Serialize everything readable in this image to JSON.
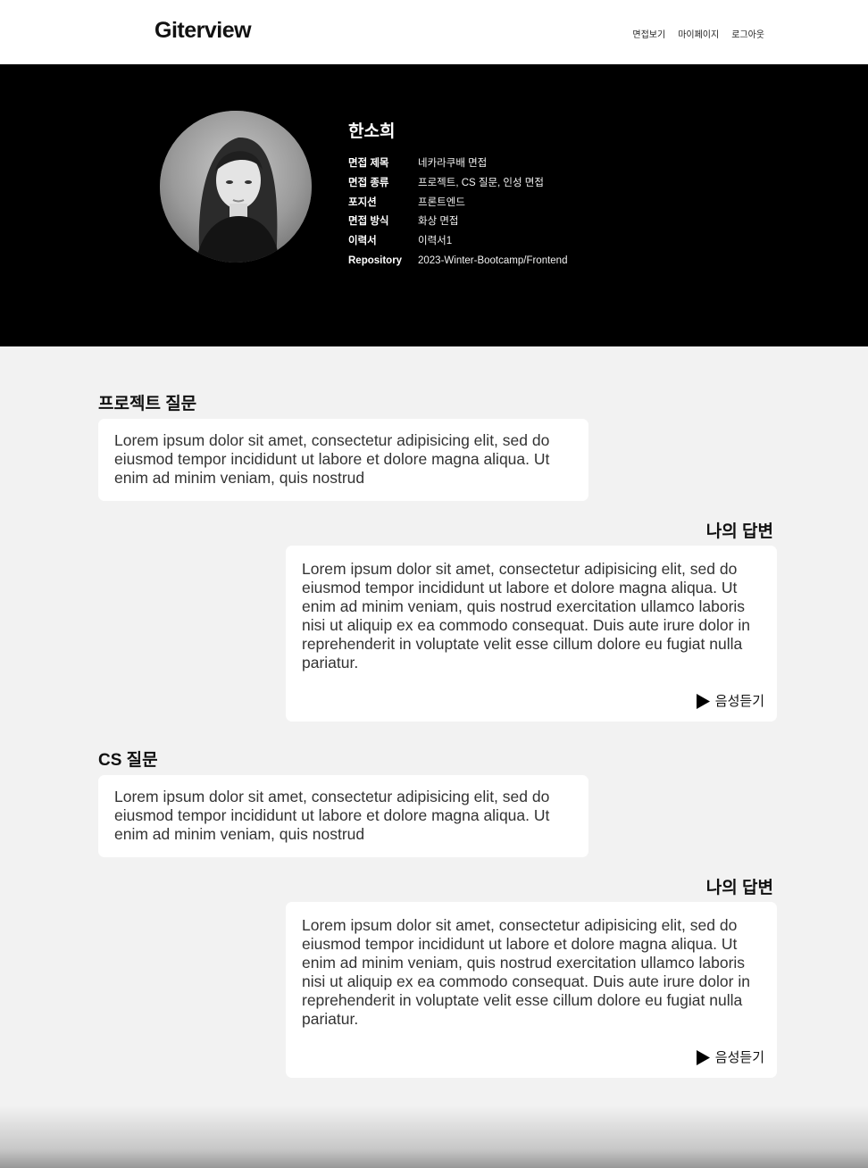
{
  "header": {
    "logo": "Giterview",
    "nav": [
      "면접보기",
      "마이페이지",
      "로그아웃"
    ]
  },
  "profile": {
    "name": "한소희",
    "fields": [
      {
        "label": "면접 제목",
        "value": "네카라쿠배 면접"
      },
      {
        "label": "면접 종류",
        "value": "프로젝트, CS 질문, 인성 면접"
      },
      {
        "label": "포지션",
        "value": "프론트엔드"
      },
      {
        "label": "면접 방식",
        "value": "화상 면접"
      },
      {
        "label": "이력서",
        "value": "이력서1"
      },
      {
        "label": "Repository",
        "value": "2023-Winter-Bootcamp/Frontend"
      }
    ]
  },
  "sections": [
    {
      "title": "프로젝트 질문",
      "question": "Lorem ipsum dolor sit amet, consectetur adipisicing elit, sed do eiusmod tempor incididunt ut labore et dolore magna aliqua. Ut enim ad minim veniam, quis nostrud",
      "answer_title": "나의 답변",
      "answer": "Lorem ipsum dolor sit amet, consectetur adipisicing elit, sed do eiusmod tempor incididunt ut labore et dolore magna aliqua. Ut enim ad minim veniam, quis nostrud exercitation ullamco laboris nisi ut aliquip ex ea commodo consequat. Duis aute irure dolor in reprehenderit in voluptate velit esse cillum dolore eu fugiat nulla pariatur.",
      "listen_label": "음성듣기"
    },
    {
      "title": "CS 질문",
      "question": "Lorem ipsum dolor sit amet, consectetur adipisicing elit, sed do eiusmod tempor incididunt ut labore et dolore magna aliqua. Ut enim ad minim veniam, quis nostrud",
      "answer_title": "나의 답변",
      "answer": "Lorem ipsum dolor sit amet, consectetur adipisicing elit, sed do eiusmod tempor incididunt ut labore et dolore magna aliqua. Ut enim ad minim veniam, quis nostrud exercitation ullamco laboris nisi ut aliquip ex ea commodo consequat. Duis aute irure dolor in reprehenderit in voluptate velit esse cillum dolore eu fugiat nulla pariatur.",
      "listen_label": "음성듣기"
    }
  ],
  "colors": {
    "hero_bg": "#000000",
    "page_bg": "#f2f2f2",
    "card_bg": "#ffffff"
  },
  "icons": {
    "avatar": "profile-photo",
    "listen": "play-icon"
  }
}
